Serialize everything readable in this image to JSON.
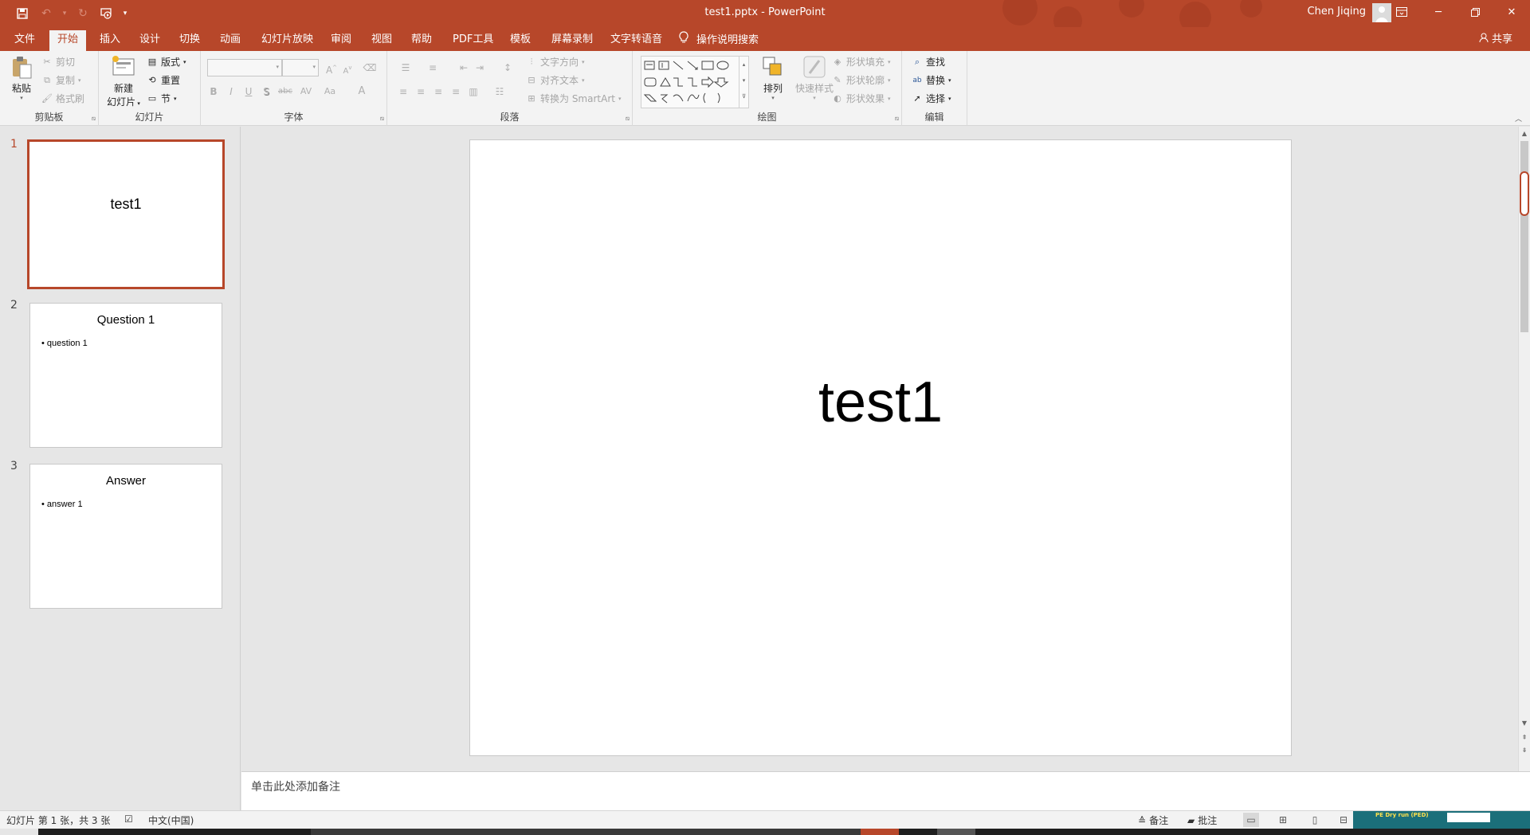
{
  "app": {
    "document_title": "test1.pptx  -  PowerPoint",
    "user_name": "Chen Jiqing"
  },
  "qat": {
    "items": [
      "save-icon",
      "undo-icon",
      "redo-icon",
      "start-from-beginning-icon",
      "customize-qat-icon"
    ]
  },
  "window_buttons": [
    "ribbon-display-options",
    "minimize",
    "restore",
    "close"
  ],
  "tabs": [
    {
      "label": "文件"
    },
    {
      "label": "开始"
    },
    {
      "label": "插入"
    },
    {
      "label": "设计"
    },
    {
      "label": "切换"
    },
    {
      "label": "动画"
    },
    {
      "label": "幻灯片放映"
    },
    {
      "label": "审阅"
    },
    {
      "label": "视图"
    },
    {
      "label": "帮助"
    },
    {
      "label": "PDF工具"
    },
    {
      "label": "模板"
    },
    {
      "label": "屏幕录制"
    },
    {
      "label": "文字转语音"
    }
  ],
  "active_tab": "开始",
  "tell_me": "操作说明搜索",
  "share": "共享",
  "ribbon": {
    "clipboard": {
      "label": "剪贴板",
      "paste": "粘贴",
      "cut": "剪切",
      "copy": "复制",
      "format_painter": "格式刷"
    },
    "slides": {
      "label": "幻灯片",
      "new_slide_line1": "新建",
      "new_slide_line2": "幻灯片",
      "layout": "版式",
      "reset": "重置",
      "section": "节"
    },
    "font": {
      "label": "字体",
      "bold": "B",
      "italic": "I",
      "underline": "U",
      "shadow": "S",
      "strikethrough": "abc",
      "spacing": "AV",
      "change_case": "Aa",
      "font_color": "A"
    },
    "paragraph": {
      "label": "段落",
      "text_direction": "文字方向",
      "align_text": "对齐文本",
      "convert_smartart": "转换为 SmartArt"
    },
    "drawing": {
      "label": "绘图",
      "arrange": "排列",
      "quick_styles": "快速样式",
      "shape_fill": "形状填充",
      "shape_outline": "形状轮廓",
      "shape_effects": "形状效果"
    },
    "editing": {
      "label": "编辑",
      "find": "查找",
      "replace": "替换",
      "select": "选择"
    }
  },
  "slides": [
    {
      "number": "1",
      "title": "test1",
      "bullet": ""
    },
    {
      "number": "2",
      "title": "Question 1",
      "bullet": "question 1"
    },
    {
      "number": "3",
      "title": "Answer",
      "bullet": "answer 1"
    }
  ],
  "current_slide": {
    "title": "test1"
  },
  "notes_placeholder": "单击此处添加备注",
  "status": {
    "slide_info": "幻灯片 第 1 张，共 3 张",
    "language": "中文(中国)",
    "notes": "备注",
    "comments": "批注"
  },
  "preview_thumbnail": {
    "title": "PE Dry run (PED)"
  },
  "colors": {
    "accent": "#b7472a",
    "ribbon_bg": "#f3f3f3",
    "canvas_bg": "#e6e6e6"
  }
}
